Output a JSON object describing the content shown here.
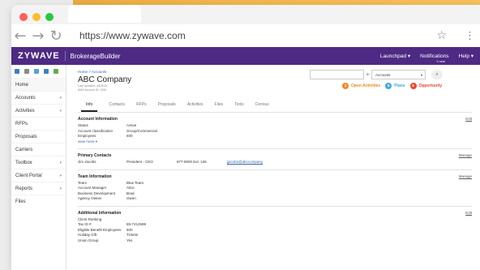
{
  "browser": {
    "url": "https://www.zywave.com"
  },
  "appbar": {
    "logo": "ZYWAVE",
    "product": "BrokerageBuilder",
    "links": [
      "Launchpad ▾",
      "Notifications",
      "Help ▾"
    ],
    "notifications_sub": "1 new"
  },
  "sidebar": {
    "items": [
      {
        "label": "Home",
        "chevron": ""
      },
      {
        "label": "Accounts",
        "chevron": "▾"
      },
      {
        "label": "Activities",
        "chevron": "▾"
      },
      {
        "label": "RFPs",
        "chevron": ""
      },
      {
        "label": "Proposals",
        "chevron": ""
      },
      {
        "label": "Carriers",
        "chevron": ""
      },
      {
        "label": "Toolbox",
        "chevron": "▾"
      },
      {
        "label": "Client Portal",
        "chevron": "▾"
      },
      {
        "label": "Reports",
        "chevron": "▾"
      },
      {
        "label": "Files",
        "chevron": ""
      }
    ]
  },
  "search": {
    "in_label": "in",
    "scope": "Accounts"
  },
  "header": {
    "breadcrumb": "Home > Accounts",
    "company": "ABC Company",
    "last_updated": "Last Updated: 4/8/2019",
    "account_id": "AMS Account ID: 1900"
  },
  "badges": [
    {
      "count": "3",
      "label": "Open Activities"
    },
    {
      "count": "6",
      "label": "Plans"
    },
    {
      "count": "5",
      "label": "Opportunity"
    }
  ],
  "tabs": [
    "Info",
    "Contacts",
    "RFPs",
    "Proposals",
    "Activities",
    "Files",
    "Tools",
    "Census"
  ],
  "account_info": {
    "title": "Account Information",
    "action": "Edit",
    "rows": [
      {
        "k": "Status",
        "v": "Active"
      },
      {
        "k": "Account classification",
        "v": "Group/Commercial"
      },
      {
        "k": "Employees",
        "v": "600"
      }
    ],
    "view_more": "view more ▾"
  },
  "primary_contacts": {
    "title": "Primary Contacts",
    "action": "Manage",
    "rows": [
      {
        "name": "Jim Jacobs",
        "role": "President - CEO",
        "phone": "877-8000 Ext. 126",
        "email": "jjacobs@abccompany"
      }
    ]
  },
  "team_info": {
    "title": "Team Information",
    "action": "Manage",
    "rows": [
      {
        "k": "Team",
        "v": "Blue Team"
      },
      {
        "k": "Account Manager",
        "v": "Alice"
      },
      {
        "k": "Business Development",
        "v": "Brad"
      },
      {
        "k": "Agency Owner",
        "v": "Owen"
      }
    ]
  },
  "additional_info": {
    "title": "Additional Information",
    "action": "Edit",
    "rows": [
      {
        "k": "Client Ranking",
        "v": ""
      },
      {
        "k": "Tax ID #",
        "v": "85-7412589"
      },
      {
        "k": "Eligible Benefit Employees",
        "v": "500"
      },
      {
        "k": "Holiday Gift",
        "v": "Tickets"
      },
      {
        "k": "Union Group",
        "v": "Yes"
      }
    ]
  }
}
